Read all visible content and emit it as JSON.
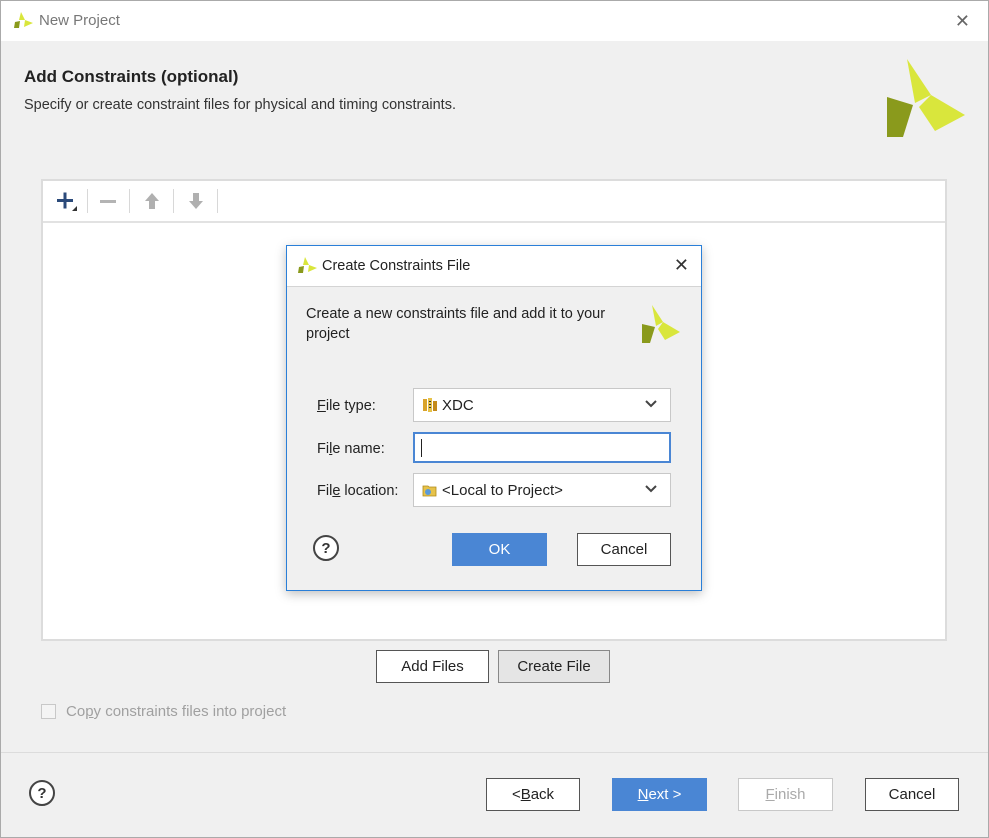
{
  "window": {
    "title": "New Project"
  },
  "page": {
    "heading": "Add Constraints (optional)",
    "subheading": "Specify or create constraint files for physical and timing constraints."
  },
  "toolbar": {
    "icons": [
      "add-icon",
      "remove-icon",
      "move-up-icon",
      "move-down-icon"
    ]
  },
  "actions": {
    "add_files": "Add Files",
    "create_file": "Create File"
  },
  "copy_checkbox": {
    "label_pre": "Co",
    "label_u": "p",
    "label_post": "y constraints files into project",
    "checked": false
  },
  "footer": {
    "help": "?",
    "back_pre": "< ",
    "back_u": "B",
    "back_post": "ack",
    "next_u": "N",
    "next_post": "ext >",
    "finish_u": "F",
    "finish_post": "inish",
    "cancel": "Cancel"
  },
  "dialog": {
    "title": "Create Constraints File",
    "description": "Create a new constraints file and add it to your project",
    "file_type": {
      "label_u": "F",
      "label_post": "ile type:",
      "value": "XDC"
    },
    "file_name": {
      "label_pre": "Fi",
      "label_u": "l",
      "label_post": "e name:",
      "value": ""
    },
    "file_location": {
      "label_pre": "Fil",
      "label_u": "e",
      "label_post": " location:",
      "value": "<Local to Project>"
    },
    "help": "?",
    "ok": "OK",
    "cancel": "Cancel"
  },
  "colors": {
    "primary_button": "#4a86d4",
    "logo_light": "#d9e63c",
    "logo_dark": "#8a9a1c",
    "dialog_border": "#2a7fd8"
  }
}
